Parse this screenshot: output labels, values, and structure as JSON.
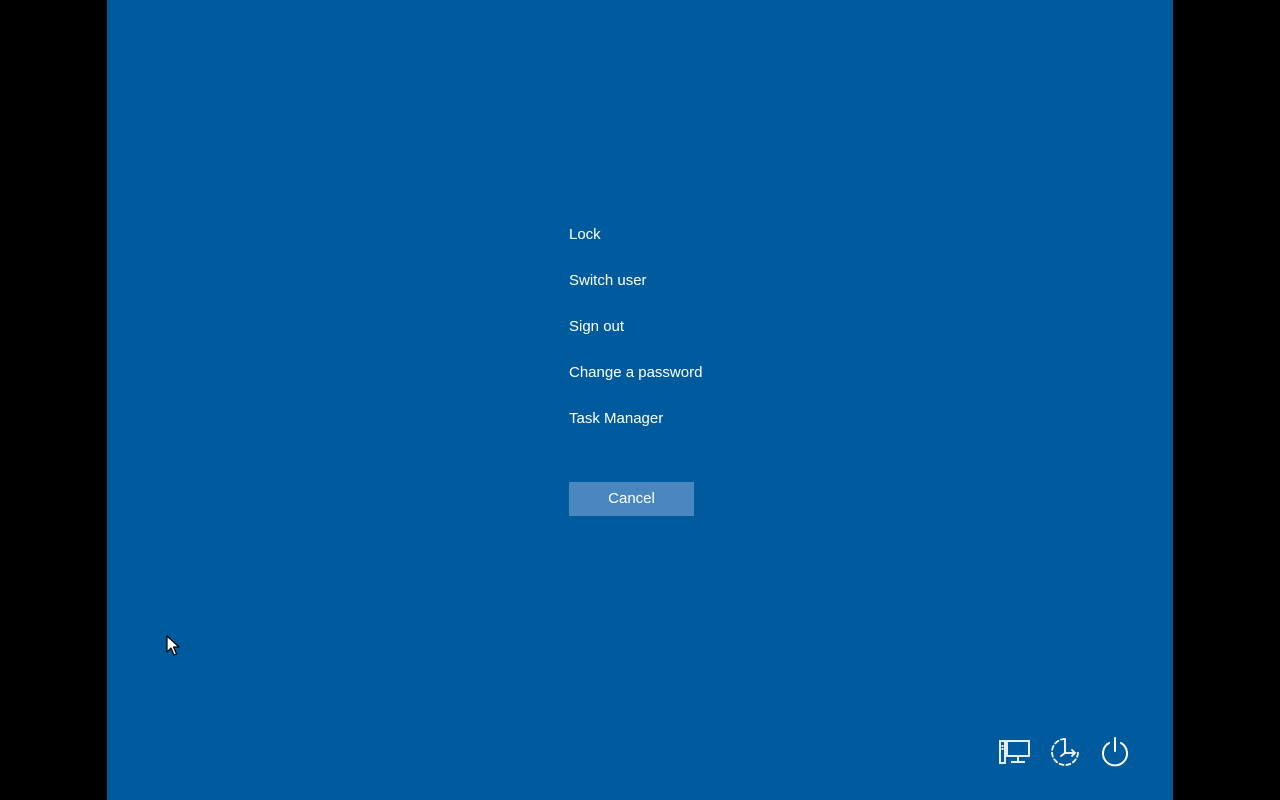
{
  "menu": {
    "items": [
      {
        "label": "Lock"
      },
      {
        "label": "Switch user"
      },
      {
        "label": "Sign out"
      },
      {
        "label": "Change a password"
      },
      {
        "label": "Task Manager"
      }
    ]
  },
  "cancel_button": {
    "label": "Cancel"
  },
  "bottom_icons": [
    {
      "icon": "network-icon"
    },
    {
      "icon": "ease-of-access-icon"
    },
    {
      "icon": "power-icon"
    }
  ],
  "colors": {
    "background": "#005a9e",
    "button": "#4a87bf",
    "text": "#ffffff",
    "letterbox": "#000000"
  }
}
